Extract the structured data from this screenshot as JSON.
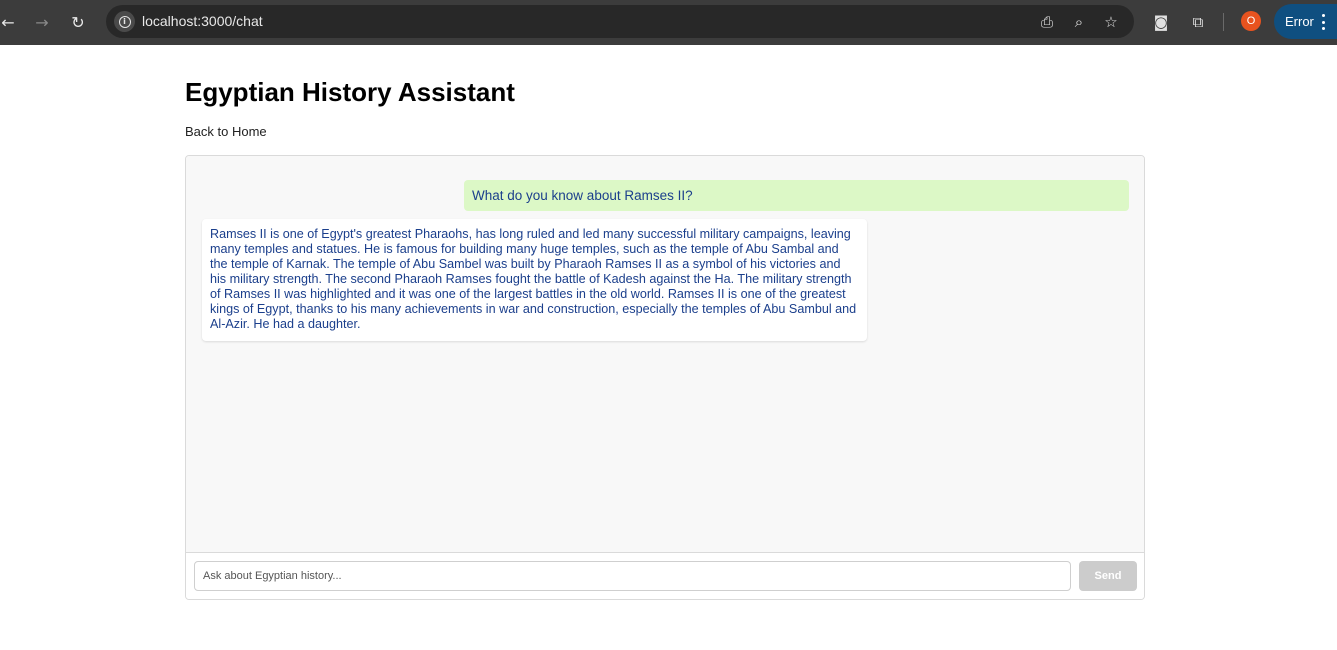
{
  "browser": {
    "url": "localhost:3000/chat",
    "profile_initial": "O",
    "status_label": "Error",
    "icons": [
      "back-arrow-icon",
      "forward-arrow-icon",
      "reload-icon",
      "info-icon",
      "install-app-icon",
      "zoom-icon",
      "bookmark-star-icon",
      "incognito-icon",
      "extensions-icon",
      "kebab-menu-icon"
    ]
  },
  "page": {
    "title": "Egyptian History Assistant",
    "back_link": "Back to Home"
  },
  "chat": {
    "messages": [
      {
        "role": "user",
        "text": "What do you know about Ramses II?"
      },
      {
        "role": "assistant",
        "text": "Ramses II is one of Egypt's greatest Pharaohs, has long ruled and led many successful military campaigns, leaving many temples and statues. He is famous for building many huge temples, such as the temple of Abu Sambal and the temple of Karnak. The temple of Abu Sambel was built by Pharaoh Ramses II as a symbol of his victories and his military strength. The second Pharaoh Ramses fought the battle of Kadesh against the Ha. The military strength of Ramses II was highlighted and it was one of the largest battles in the old world. Ramses II is one of the greatest kings of Egypt, thanks to his many achievements in war and construction, especially the temples of Abu Sambul and Al-Azir. He had a daughter."
      }
    ],
    "input_placeholder": "Ask about Egyptian history...",
    "input_value": "",
    "send_label": "Send"
  },
  "colors": {
    "user_bubble": "#dcf8c6",
    "message_text": "#1b3f8c",
    "send_disabled": "#cccccc",
    "profile_badge": "#e8531f",
    "error_pill": "#0f4f80"
  }
}
